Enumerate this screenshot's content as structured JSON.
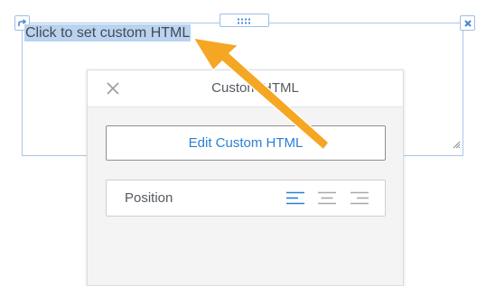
{
  "editor": {
    "placeholder_text": "Click to set custom HTML"
  },
  "panel": {
    "title": "Custom HTML",
    "edit_button_label": "Edit Custom HTML",
    "position_label": "Position",
    "alignment_options": [
      "left",
      "center",
      "right"
    ],
    "selected_alignment": "left"
  },
  "icons": {
    "move": "move-arrow-icon",
    "delete": "close-x-icon",
    "drag": "drag-dots-icon",
    "resize": "resize-grip-icon",
    "panel_close": "close-icon",
    "align_left": "align-left-icon",
    "align_center": "align-center-icon",
    "align_right": "align-right-icon"
  },
  "colors": {
    "accent": "#2a7fd4",
    "selection": "#b9d3f0",
    "element_outline": "#a9c6e8",
    "annotation_arrow": "#f5a623"
  }
}
